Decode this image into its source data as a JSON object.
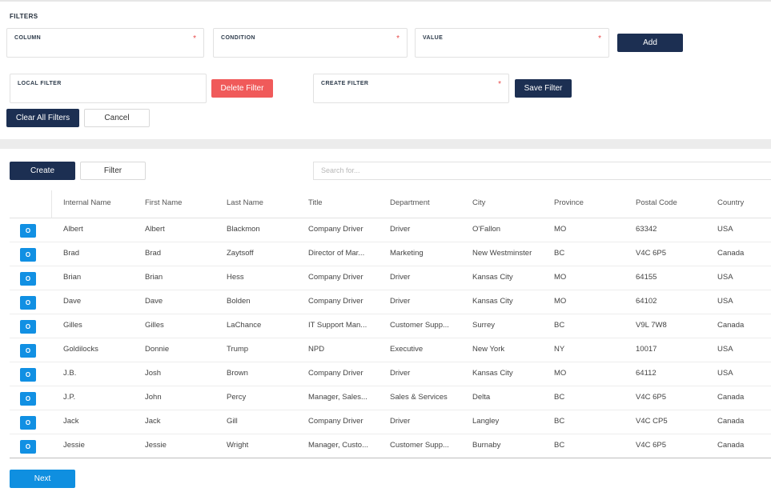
{
  "filters": {
    "title": "FILTERS",
    "column_label": "COLUMN",
    "condition_label": "CONDITION",
    "value_label": "VALUE",
    "required_mark": "*",
    "add_label": "Add",
    "local_filter_label": "LOCAL FILTER",
    "delete_filter_label": "Delete Filter",
    "create_filter_label": "CREATE FILTER",
    "save_filter_label": "Save Filter",
    "clear_all_label": "Clear All Filters",
    "cancel_label": "Cancel"
  },
  "toolbar": {
    "create_label": "Create",
    "filter_label": "Filter",
    "search_placeholder": "Search for..."
  },
  "table": {
    "columns": [
      "Internal Name",
      "First Name",
      "Last Name",
      "Title",
      "Department",
      "City",
      "Province",
      "Postal Code",
      "Country"
    ],
    "row_button_label": "O",
    "rows": [
      [
        "Albert",
        "Albert",
        "Blackmon",
        "Company Driver",
        "Driver",
        "O'Fallon",
        "MO",
        "63342",
        "USA"
      ],
      [
        "Brad",
        "Brad",
        "Zaytsoff",
        "Director of Mar...",
        "Marketing",
        "New Westminster",
        "BC",
        "V4C 6P5",
        "Canada"
      ],
      [
        "Brian",
        "Brian",
        "Hess",
        "Company Driver",
        "Driver",
        "Kansas City",
        "MO",
        "64155",
        "USA"
      ],
      [
        "Dave",
        "Dave",
        "Bolden",
        "Company Driver",
        "Driver",
        "Kansas City",
        "MO",
        "64102",
        "USA"
      ],
      [
        "Gilles",
        "Gilles",
        "LaChance",
        "IT Support Man...",
        "Customer Supp...",
        "Surrey",
        "BC",
        "V9L 7W8",
        "Canada"
      ],
      [
        "Goldilocks",
        "Donnie",
        "Trump",
        "NPD",
        "Executive",
        "New York",
        "NY",
        "10017",
        "USA"
      ],
      [
        "J.B.",
        "Josh",
        "Brown",
        "Company Driver",
        "Driver",
        "Kansas City",
        "MO",
        "64112",
        "USA"
      ],
      [
        "J.P.",
        "John",
        "Percy",
        "Manager, Sales...",
        "Sales & Services",
        "Delta",
        "BC",
        "V4C 6P5",
        "Canada"
      ],
      [
        "Jack",
        "Jack",
        "Gill",
        "Company Driver",
        "Driver",
        "Langley",
        "BC",
        "V4C CP5",
        "Canada"
      ],
      [
        "Jessie",
        "Jessie",
        "Wright",
        "Manager, Custo...",
        "Customer Supp...",
        "Burnaby",
        "BC",
        "V4C 6P5",
        "Canada"
      ]
    ]
  },
  "pagination": {
    "next_label": "Next"
  }
}
